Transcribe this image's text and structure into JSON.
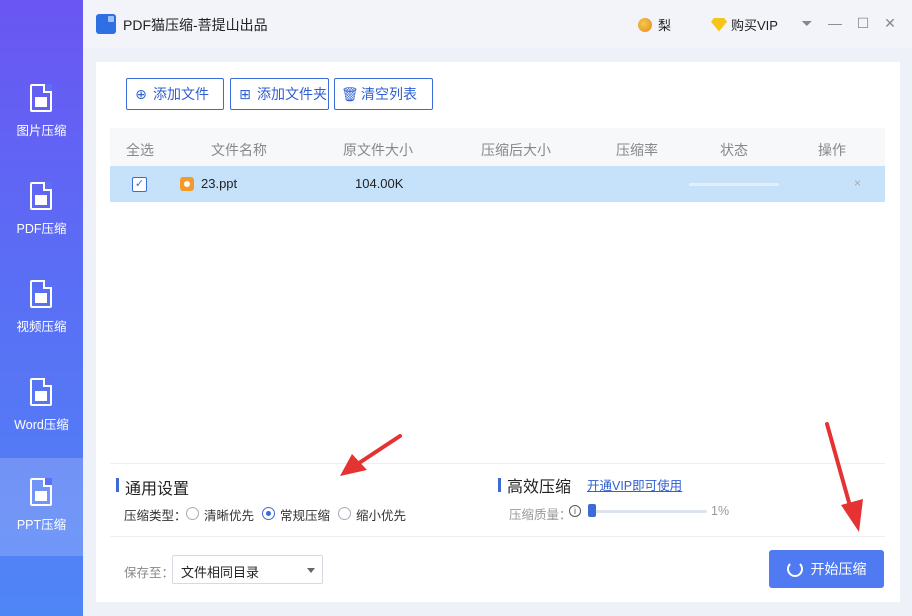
{
  "window": {
    "title": "PDF猫压缩-菩提山出品",
    "user_name": "梨",
    "vip_label": "购买VIP"
  },
  "sidebar": {
    "items": [
      {
        "label": "图片压缩",
        "icon": "image-file-icon"
      },
      {
        "label": "PDF压缩",
        "icon": "pdf-file-icon"
      },
      {
        "label": "视频压缩",
        "icon": "video-file-icon"
      },
      {
        "label": "Word压缩",
        "icon": "word-file-icon"
      },
      {
        "label": "PPT压缩",
        "icon": "ppt-file-icon",
        "active": true
      }
    ]
  },
  "toolbar": {
    "add_file": "添加文件",
    "add_folder": "添加文件夹",
    "clear_list": "清空列表"
  },
  "table": {
    "headers": [
      "全选",
      "文件名称",
      "原文件大小",
      "压缩后大小",
      "压缩率",
      "状态",
      "操作"
    ],
    "rows": [
      {
        "checked": true,
        "name": "23.ppt",
        "original_size": "104.00K",
        "compressed_size": "",
        "ratio": "",
        "progress": 0,
        "action": "×"
      }
    ]
  },
  "settings": {
    "general_title": "通用设置",
    "type_label": "压缩类型：",
    "options": [
      "清晰优先",
      "常规压缩",
      "缩小优先"
    ],
    "selected_option": "常规压缩",
    "efficient_title": "高效压缩",
    "vip_link": "开通VIP即可使用",
    "quality_label": "压缩质量：",
    "quality_value": "1%"
  },
  "footer": {
    "save_label": "保存至：",
    "save_target": "文件相同目录",
    "start_button": "开始压缩"
  },
  "colors": {
    "accent": "#3a6bd8",
    "row_highlight": "#c6e2fb",
    "start_button": "#4f7af2",
    "annotation_arrow": "#e53232"
  }
}
